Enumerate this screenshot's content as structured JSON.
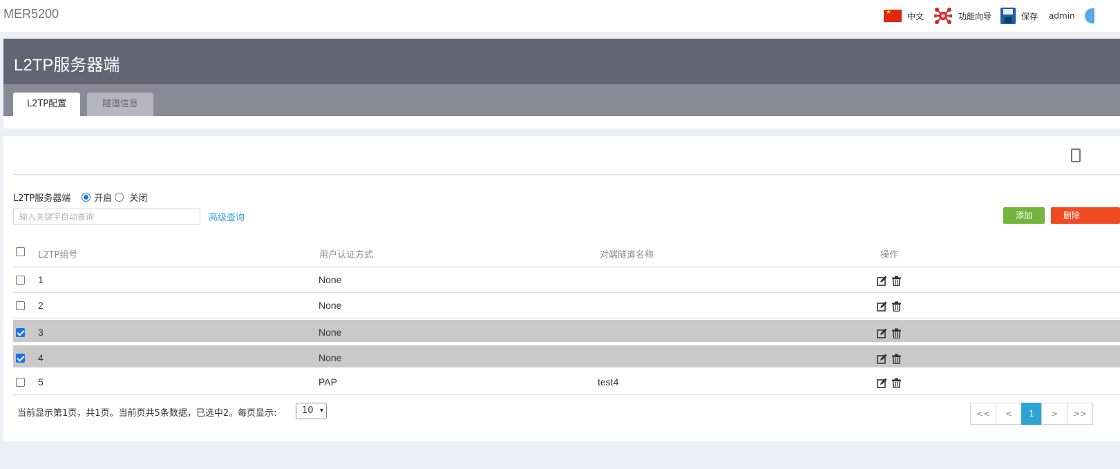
{
  "app": {
    "brand": "MER5200"
  },
  "topbar": {
    "language": "中文",
    "wizard": "功能向导",
    "save": "保存",
    "user": "admin"
  },
  "panel": {
    "title": "L2TP服务器端"
  },
  "tabs": [
    {
      "label": "L2TP配置",
      "active": true
    },
    {
      "label": "隧道信息",
      "active": false
    }
  ],
  "server": {
    "label": "L2TP服务器端",
    "option_on": "开启",
    "option_off": "关闭",
    "selected": "开启"
  },
  "search": {
    "placeholder": "输入关键字自动查询",
    "value": "",
    "advanced": "高级查询"
  },
  "buttons": {
    "add": "添加",
    "delete": "删除"
  },
  "table": {
    "headers": [
      "L2TP组号",
      "用户认证方式",
      "对端隧道名称",
      "操作"
    ],
    "rows": [
      {
        "id": "1",
        "auth": "None",
        "peer": "",
        "checked": false
      },
      {
        "id": "2",
        "auth": "None",
        "peer": "",
        "checked": false
      },
      {
        "id": "3",
        "auth": "None",
        "peer": "",
        "checked": true
      },
      {
        "id": "4",
        "auth": "None",
        "peer": "",
        "checked": true
      },
      {
        "id": "5",
        "auth": "PAP",
        "peer": "test4",
        "checked": false
      }
    ]
  },
  "footer": {
    "summary": "当前显示第1页，共1页。当前页共5条数据，已选中2。每页显示:",
    "page_size": "10"
  },
  "pager": {
    "first": "<<",
    "prev": "<",
    "current": "1",
    "next": ">",
    "last": ">>"
  },
  "colors": {
    "header_bg": "#636474",
    "tab_bg": "#8a8996",
    "add": "#76b43e",
    "delete": "#f04a22",
    "accent": "#2ea3d6",
    "selected_row": "#c9c9c9"
  }
}
